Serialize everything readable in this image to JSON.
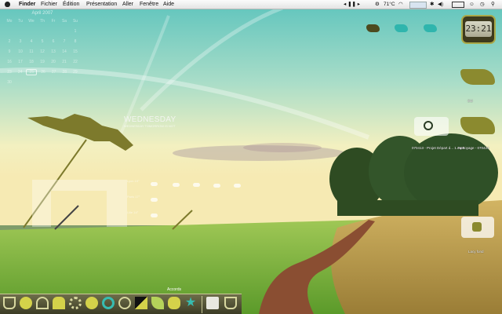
{
  "menubar": {
    "app_name": "Finder",
    "menus": [
      "Fichier",
      "Édition",
      "Présentation",
      "Aller",
      "Fenêtre",
      "Aide"
    ],
    "temperature": "71°C"
  },
  "calendar": {
    "title": "April 2007",
    "weekdays": [
      "Mo",
      "Tu",
      "We",
      "Th",
      "Fr",
      "Sa",
      "Su"
    ],
    "weeks": [
      [
        "",
        "",
        "",
        "",
        "",
        "",
        "1"
      ],
      [
        "2",
        "3",
        "4",
        "5",
        "6",
        "7",
        "8"
      ],
      [
        "9",
        "10",
        "11",
        "12",
        "13",
        "14",
        "15"
      ],
      [
        "16",
        "17",
        "18",
        "19",
        "20",
        "21",
        "22"
      ],
      [
        "23",
        "24",
        "25",
        "26",
        "27",
        "28",
        "29"
      ],
      [
        "30",
        "",
        "",
        "",
        "",
        "",
        ""
      ]
    ],
    "today": "25"
  },
  "clock": {
    "time": "23:21"
  },
  "day_widget": {
    "day": "WEDNESDAY",
    "subtitle": "WEDNESDAY TOMORROW IS NOT"
  },
  "desktop_items": [
    {
      "label": "Sid"
    },
    {
      "label": "070413 - Projet Départ d... 1.mp3"
    },
    {
      "label": "Nettoyage - 070424"
    },
    {
      "label": "Lacy fond"
    }
  ],
  "weather": {
    "rows": [
      {
        "city": "Lyon",
        "temp": "19°"
      },
      {
        "city": "Paris",
        "temp": "17°"
      },
      {
        "city": "Lille",
        "temp": "14°"
      }
    ]
  },
  "dock": {
    "label": "Accords"
  },
  "colors": {
    "olive": "#8b8b2e",
    "olive_dark": "#3d3a1e",
    "teal": "#37bcb1",
    "sky_top": "#69c9c1",
    "field": "#7fbb40"
  }
}
